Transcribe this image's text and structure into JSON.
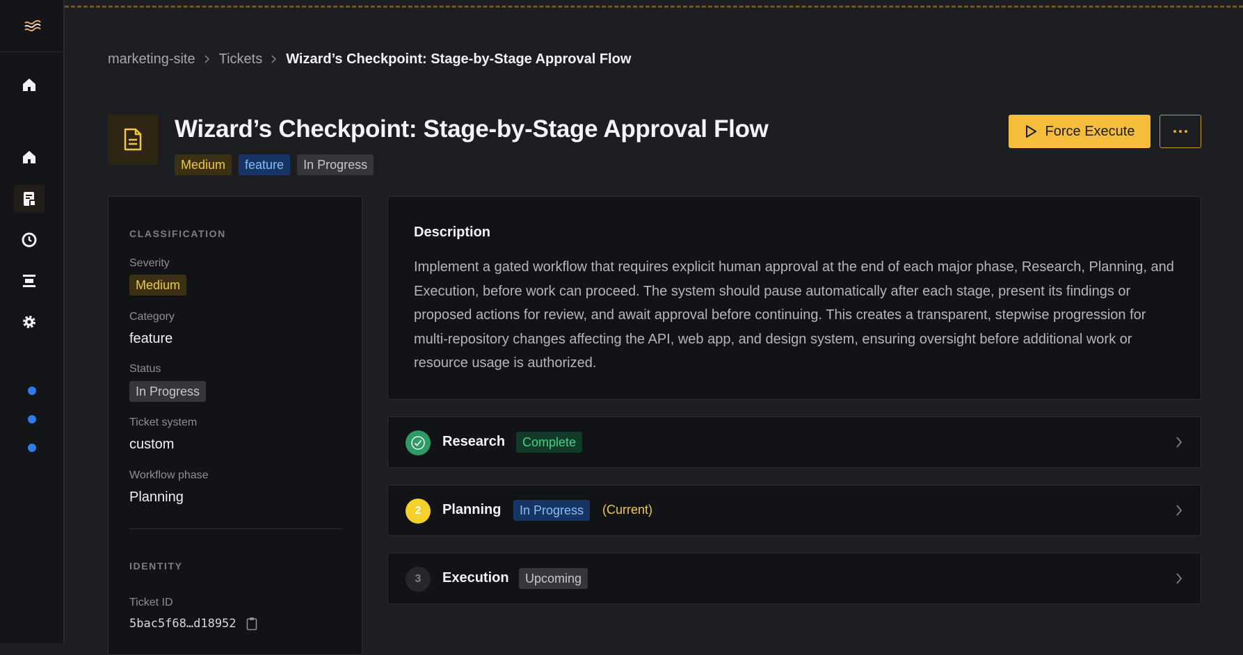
{
  "colors": {
    "accent": "#f6bd3a",
    "background": "#1d1e21",
    "panel": "#121316",
    "complete": "#2f9a67",
    "current": "#f4d22a",
    "info_blue": "#8bbcf5"
  },
  "sidebar": {
    "logo_icon": "wave-logo-icon",
    "items": [
      {
        "icon": "home-icon"
      },
      {
        "icon": "home-icon"
      },
      {
        "icon": "ticket-icon",
        "active": true
      },
      {
        "icon": "clock-icon"
      },
      {
        "icon": "list-icon"
      },
      {
        "icon": "gear-icon"
      }
    ],
    "status_dots": 3
  },
  "breadcrumb": {
    "items": [
      "marketing-site",
      "Tickets",
      "Wizard’s Checkpoint: Stage-by-Stage Approval Flow"
    ]
  },
  "header": {
    "title": "Wizard’s Checkpoint: Stage-by-Stage Approval Flow",
    "tags": [
      "Medium",
      "feature",
      "In Progress"
    ],
    "force_execute_label": "Force Execute",
    "more_icon": "more-horizontal-icon"
  },
  "details": {
    "classification_heading": "CLASSIFICATION",
    "severity_label": "Severity",
    "severity_value": "Medium",
    "category_label": "Category",
    "category_value": "feature",
    "status_label": "Status",
    "status_value": "In Progress",
    "ticket_system_label": "Ticket system",
    "ticket_system_value": "custom",
    "workflow_phase_label": "Workflow phase",
    "workflow_phase_value": "Planning",
    "identity_heading": "IDENTITY",
    "ticket_id_label": "Ticket ID",
    "ticket_id_value": "5bac5f68…d18952"
  },
  "description": {
    "title": "Description",
    "body": "Implement a gated workflow that requires explicit human approval at the end of each major phase, Research, Planning, and Execution, before work can proceed. The system should pause automatically after each stage, present its findings or proposed actions for review, and await approval before continuing. This creates a transparent, stepwise progression for multi-repository changes affecting the API, web app, and design system, ensuring oversight before additional work or resource usage is authorized."
  },
  "phases": [
    {
      "badge": "",
      "name": "Research",
      "status": "Complete",
      "note": ""
    },
    {
      "badge": "2",
      "name": "Planning",
      "status": "In Progress",
      "note": "(Current)"
    },
    {
      "badge": "3",
      "name": "Execution",
      "status": "Upcoming",
      "note": ""
    }
  ]
}
